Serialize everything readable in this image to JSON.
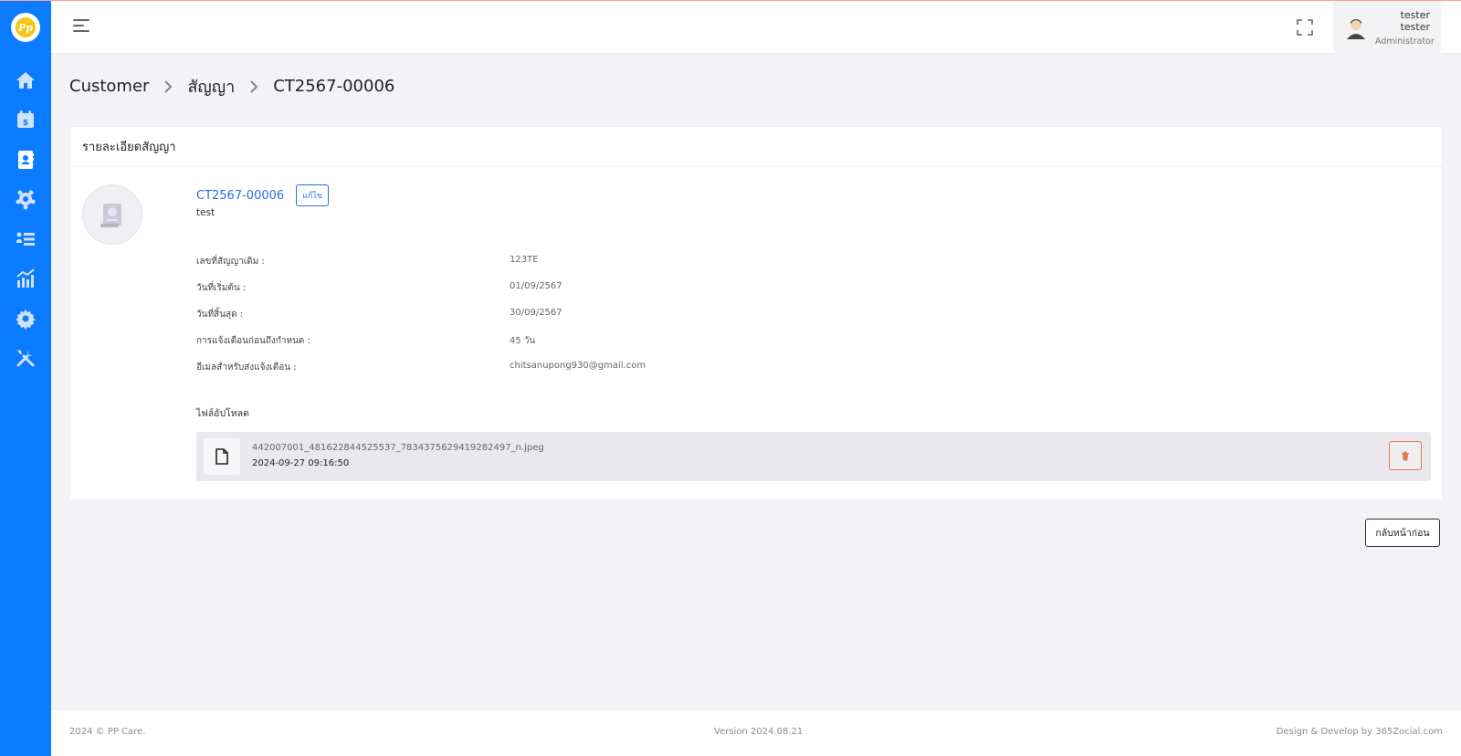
{
  "app": {
    "logo_text": "Pp",
    "accent_color": "#0b7bff"
  },
  "sidebar": {
    "items": [
      {
        "icon": "home-icon"
      },
      {
        "icon": "billing-calendar-icon"
      },
      {
        "icon": "contact-book-icon"
      },
      {
        "icon": "team-icon"
      },
      {
        "icon": "list-icon"
      },
      {
        "icon": "chart-icon"
      },
      {
        "icon": "settings-icon"
      },
      {
        "icon": "tools-icon"
      }
    ]
  },
  "header": {
    "user_name": "tester tester",
    "user_role": "Administrator"
  },
  "breadcrumb": {
    "items": [
      "Customer",
      "สัญญา",
      "CT2567-00006"
    ]
  },
  "card": {
    "title": "รายละเอียดสัญญา",
    "contract_no": "CT2567-00006",
    "edit_label": "แก้ไข",
    "description": "test",
    "details": [
      {
        "label": "เลขที่สัญญาเดิม :",
        "value": "123TE"
      },
      {
        "label": "วันที่เริ่มต้น :",
        "value": "01/09/2567"
      },
      {
        "label": "วันที่สิ้นสุด :",
        "value": "30/09/2567"
      },
      {
        "label": "การแจ้งเตือนก่อนถึงกำหนด :",
        "value": "45 วัน"
      },
      {
        "label": "อีเมลสำหรับส่งแจ้งเตือน :",
        "value": "chitsanupong930@gmail.com"
      }
    ],
    "upload_title": "ไฟล์อัปโหลด",
    "file": {
      "name": "442007001_481622844525537_7834375629419282497_n.jpeg",
      "date": "2024-09-27 09:16:50"
    }
  },
  "actions": {
    "back_label": "กลับหน้าก่อน"
  },
  "footer": {
    "left": "2024 © PP Care.",
    "center": "Version 2024.08.21",
    "right": "Design & Develop by 365Zocial.com"
  }
}
